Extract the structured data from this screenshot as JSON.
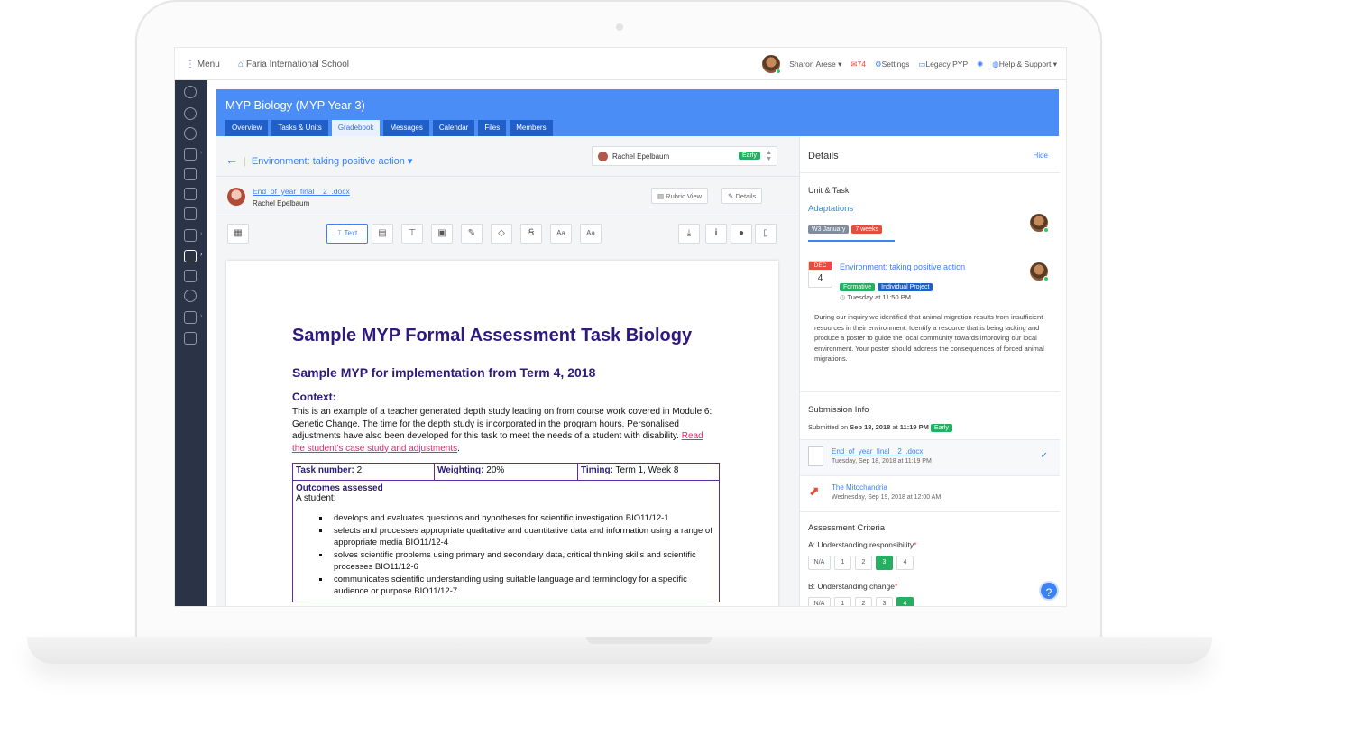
{
  "topbar": {
    "menu_label": "Menu",
    "school_name": "Faria International School",
    "user_name": "Sharon Arese",
    "mail_count": "74",
    "settings_label": "Settings",
    "legacy_label": "Legacy PYP",
    "help_label": "Help & Support"
  },
  "course": {
    "title": "MYP Biology (MYP Year 3)",
    "tabs": [
      "Overview",
      "Tasks & Units",
      "Gradebook",
      "Messages",
      "Calendar",
      "Files",
      "Members"
    ],
    "active_tab": "Gradebook"
  },
  "task": {
    "breadcrumb": "Environment: taking positive action",
    "selected_student": "Rachel Epelbaum",
    "student_badge": "Early"
  },
  "file": {
    "name": "End_of_year_final__2_.docx",
    "author": "Rachel Epelbaum",
    "rubric_button": "Rubric View",
    "details_button": "Details"
  },
  "toolbar": {
    "text_tool": "Text",
    "font_a1": "Aa",
    "font_a2": "Aa"
  },
  "document": {
    "title": "Sample MYP Formal Assessment Task Biology",
    "subtitle": "Sample MYP for implementation from Term 4, 2018",
    "context_heading": "Context:",
    "context_text": "This is an example of a teacher generated depth study leading on from course work covered in Module 6: Genetic Change. The time for the depth study is incorporated in the program hours. Personalised adjustments have also been developed for this task to meet the needs of a student with disability. ",
    "context_link": "Read the student's case study and adjustments",
    "context_end": ".",
    "task_number_label": "Task number:",
    "task_number_value": "2",
    "weighting_label": "Weighting:",
    "weighting_value": "20%",
    "timing_label": "Timing:",
    "timing_value": "Term 1, Week 8",
    "outcomes_heading": "Outcomes assessed",
    "outcomes_intro": "A student:",
    "outcomes": [
      "develops and evaluates questions and hypotheses for scientific investigation BIO11/12-1",
      "selects and processes appropriate qualitative and quantitative data and information using a range of appropriate media BIO11/12-4",
      "solves scientific problems using primary and secondary data, critical thinking skills and scientific processes BIO11/12-6",
      "communicates scientific understanding using suitable language and terminology for a specific audience or purpose BIO11/12-7"
    ]
  },
  "details": {
    "title": "Details",
    "hide_label": "Hide",
    "unit_task_label": "Unit & Task",
    "unit_name": "Adaptations",
    "unit_tag_week": "W3 January",
    "unit_tag_duration": "7 weeks",
    "unit_progress": 1.0,
    "due_month": "DEC",
    "due_day": "4",
    "task_name": "Environment: taking positive action",
    "task_tag_type": "Formative",
    "task_tag_kind": "Individual Project",
    "due_time": "Tuesday at 11:50 PM",
    "description": "During our inquiry we identified that animal migration results from insufficient resources in their environment. Identify a resource that is being lacking and produce a poster to guide the local community towards improving our local environment. Your poster should address the consequences of forced animal migrations.",
    "submission_label": "Submission Info",
    "submitted_prefix": "Submitted on ",
    "submitted_date": "Sep 18, 2018",
    "submitted_at": " at ",
    "submitted_time": "11:19 PM",
    "submitted_badge": "Early",
    "files": [
      {
        "name": "End_of_year_final__2_.docx",
        "date": "Tuesday, Sep 18, 2018 at 11:19 PM"
      },
      {
        "name": "The Mitochandria",
        "date": "Wednesday, Sep 19, 2018 at 12:00 AM"
      }
    ],
    "criteria_label": "Assessment Criteria",
    "criterion_a": "A: Understanding responsibility",
    "criterion_b": "B: Understanding change",
    "scores": [
      "N/A",
      "1",
      "2",
      "3",
      "4"
    ],
    "criterion_a_selected": "3",
    "criterion_b_selected": "4"
  },
  "colors": {
    "brand_blue": "#4a8df6",
    "sidebar": "#2b3347",
    "doc_heading": "#2e1a7c",
    "success": "#27ae60",
    "danger": "#e74c3c"
  }
}
